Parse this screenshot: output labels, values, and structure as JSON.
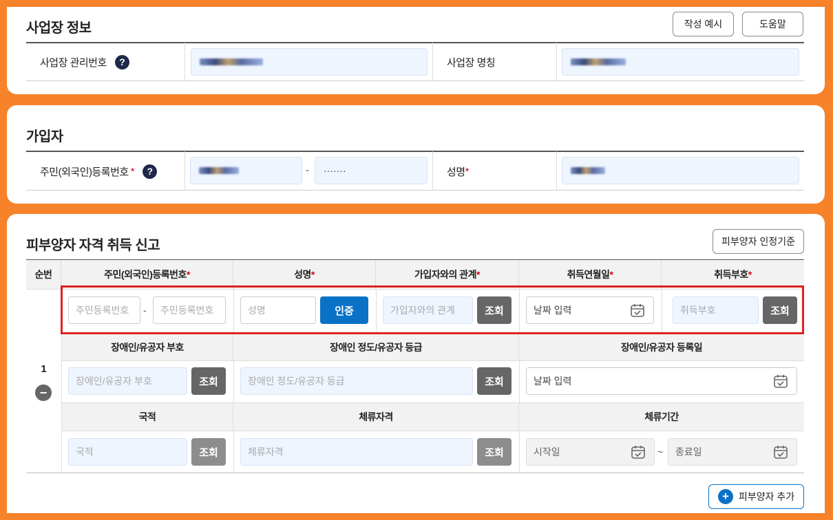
{
  "business": {
    "title": "사업장 정보",
    "example_button": "작성 예시",
    "help_button": "도움말",
    "mgmt_no_label": "사업장 관리번호",
    "name_label": "사업장 명칭",
    "help_icon": "?"
  },
  "subscriber": {
    "title": "가입자",
    "rrn_label": "주민(외국인)등록번호",
    "rrn_required": "*",
    "rrn_separator": "-",
    "rrn_back_masked": "·······",
    "name_label": "성명",
    "name_required": "*",
    "help_icon": "?"
  },
  "dependent": {
    "title": "피부양자 자격 취득 신고",
    "criteria_button": "피부양자 인정기준",
    "headers": {
      "seq": "순번",
      "rrn": "주민(외국인)등록번호",
      "name": "성명",
      "relation": "가입자와의 관계",
      "acq_date": "취득연월일",
      "acq_code": "취득부호",
      "req": "*"
    },
    "row": {
      "seq": "1",
      "remove_icon": "−",
      "rrn_front_placeholder": "주민등록번호",
      "rrn_separator": "-",
      "rrn_back_placeholder": "주민등록번호",
      "name_placeholder": "성명",
      "verify_button": "인증",
      "relation_placeholder": "가입자와의 관계",
      "lookup_button": "조회",
      "date_placeholder": "날짜 입력",
      "acq_code_placeholder": "취득부호"
    },
    "disability_headers": {
      "code": "장애인/유공자 부호",
      "grade": "장애인 정도/유공자 등급",
      "reg_date": "장애인/유공자 등록일"
    },
    "disability_row": {
      "code_placeholder": "장애인/유공자 부호",
      "grade_placeholder": "장애인 정도/유공자 등급",
      "date_placeholder": "날짜 입력"
    },
    "nationality_headers": {
      "nationality": "국적",
      "stay_status": "체류자격",
      "stay_period": "체류기간"
    },
    "nationality_row": {
      "nationality_placeholder": "국적",
      "stay_status_placeholder": "체류자격",
      "start_placeholder": "시작일",
      "tilde": "~",
      "end_placeholder": "종료일"
    },
    "add_button": "피부양자 추가",
    "add_icon": "+"
  },
  "colors": {
    "accent": "#0a72c6",
    "highlight_border": "#e02020",
    "frame": "#f6832a"
  }
}
